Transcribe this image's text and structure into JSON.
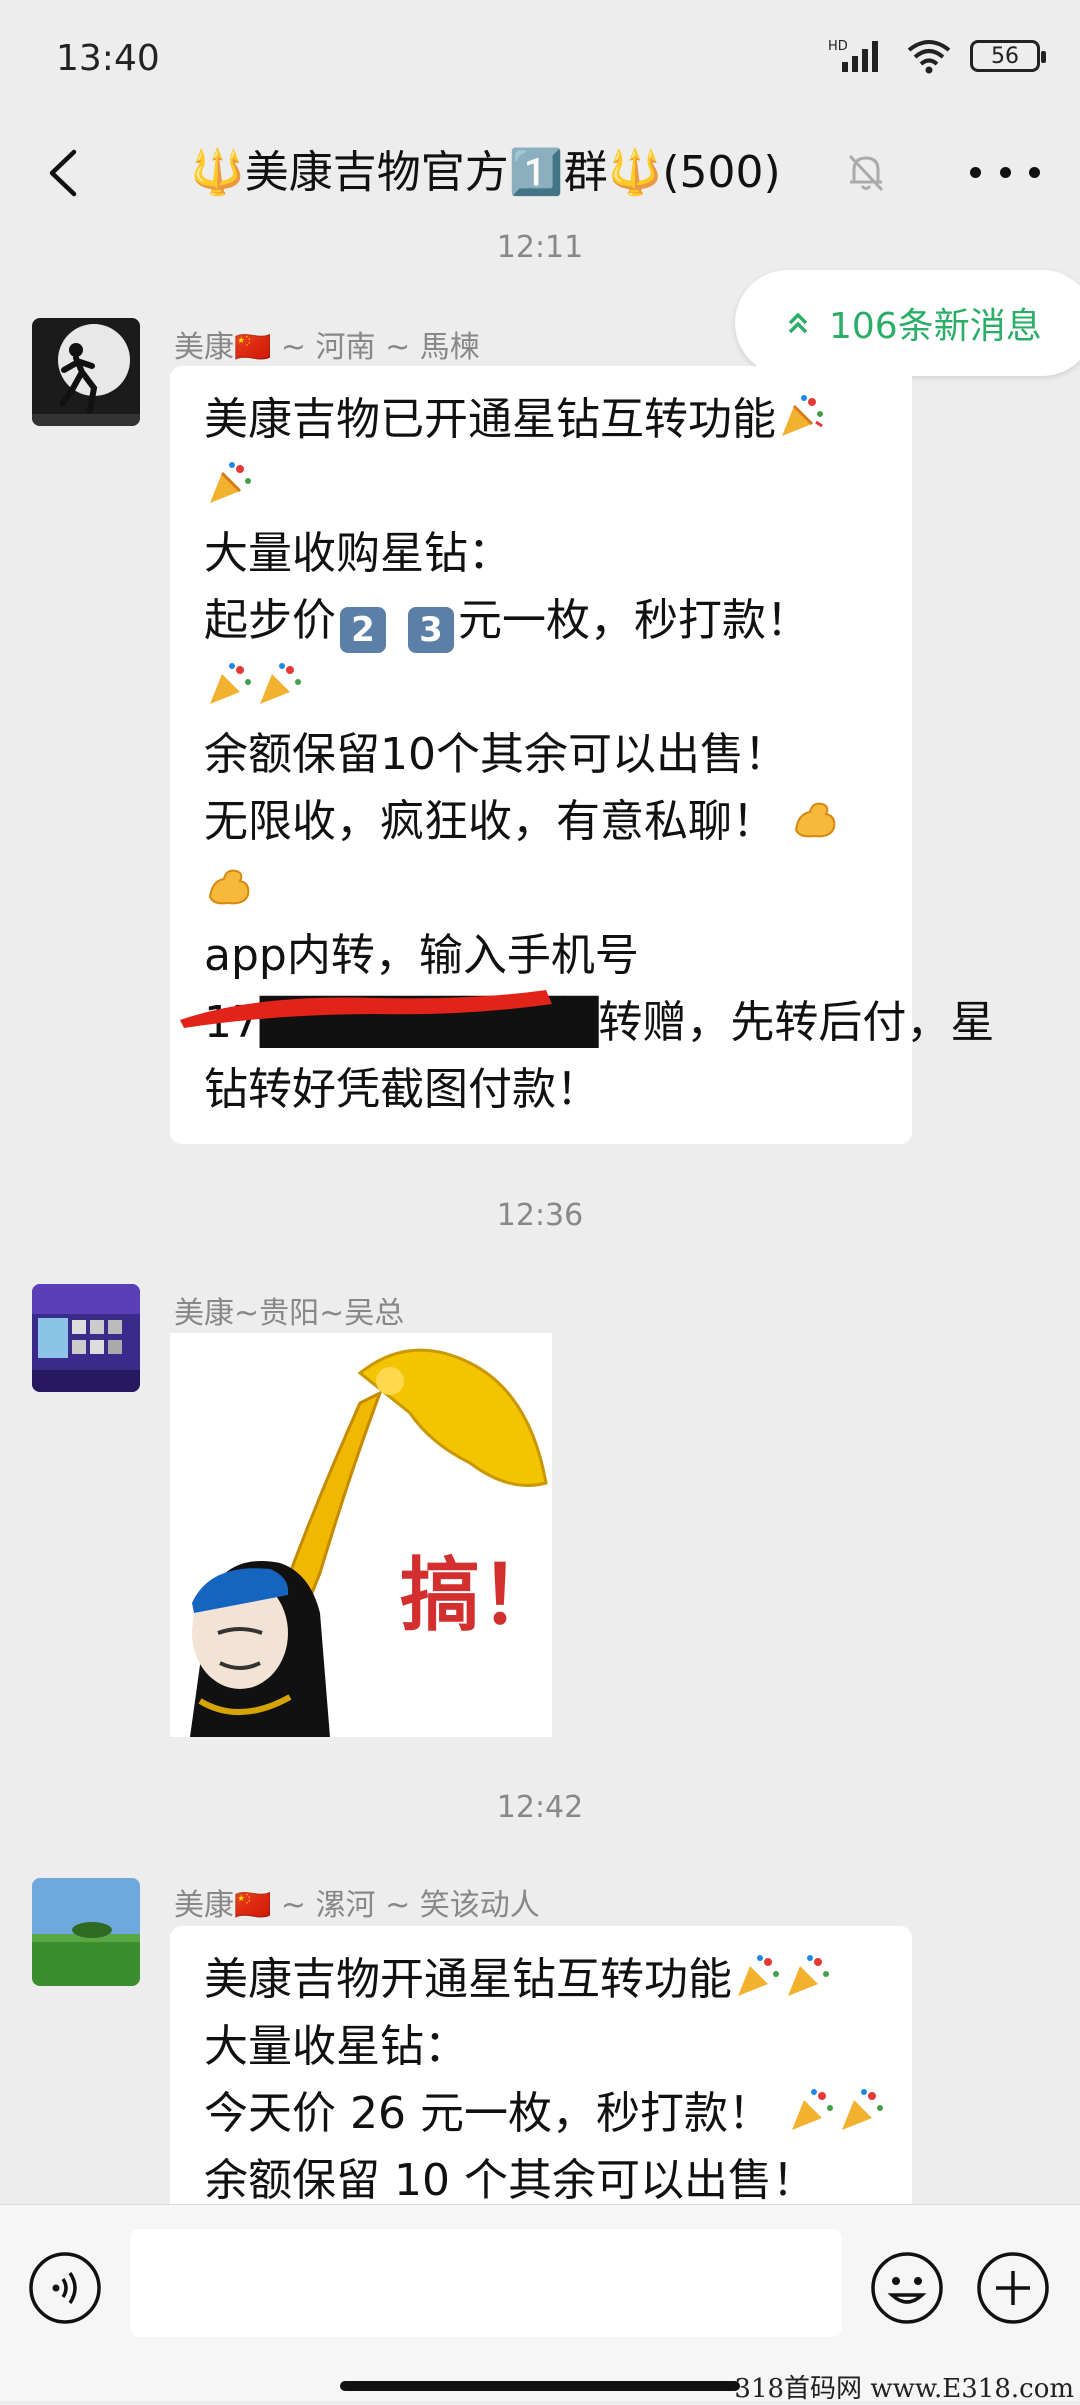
{
  "status_bar": {
    "time": "13:40",
    "network": "HD",
    "battery": "56"
  },
  "header": {
    "title": "🔱美康吉物官方1️⃣群🔱(500)"
  },
  "new_messages": {
    "label": "106条新消息"
  },
  "messages": [
    {
      "time": "12:11",
      "sender": "美康🇨🇳 ~ 河南 ~ 馬楝",
      "lines": [
        "美康吉物已开通星钻互转功能",
        "",
        "大量收购星钻：",
        "起步价",
        "",
        "余额保留10个其余可以出售！",
        "无限收，疯狂收，有意私聊！",
        "",
        "app内转，输入手机号",
        "17██████████转赠，先转后付，星",
        "钻转好凭截图付款！"
      ],
      "price_digits": [
        "2",
        "3"
      ],
      "price_suffix": "元一枚，秒打款！"
    },
    {
      "time": "12:36",
      "sender": "美康~贵阳~吴总",
      "sticker_text": "搞！"
    },
    {
      "time": "12:42",
      "sender": "美康🇨🇳 ~ 漯河 ~ 笑该动人",
      "lines": [
        "美康吉物开通星钻互转功能",
        "大量收星钻：",
        "今天价 26 元一枚，秒打款！",
        "余额保留 10 个其余可以出售！"
      ]
    }
  ],
  "watermark": "318首码网 www.E318.com"
}
